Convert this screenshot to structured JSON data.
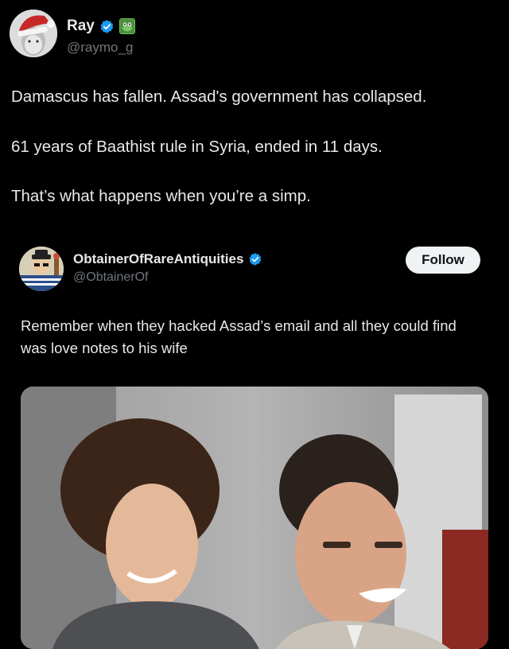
{
  "post": {
    "author": {
      "display_name": "Ray",
      "handle": "@raymo_g",
      "verified": true,
      "avatar_icon": "santa-hat-avatar",
      "badge_icon": "frog-emoji-badge"
    },
    "paragraphs": [
      "Damascus has fallen. Assad's government has collapsed.",
      "61 years of Baathist rule in Syria, ended in 11 days.",
      "That’s what happens when you’re a simp."
    ]
  },
  "quoted_post": {
    "author": {
      "display_name": "ObtainerOfRareAntiquities",
      "handle": "@ObtainerOf",
      "verified": true,
      "avatar_icon": "cartoon-avatar"
    },
    "follow_label": "Follow",
    "text": "Remember when they hacked Assad’s email and all they could find was love notes to his wife",
    "image_icon": "photo-of-smiling-couple"
  },
  "colors": {
    "background": "#000000",
    "text": "#e7e9ea",
    "secondary_text": "#71767b",
    "verified_blue": "#1d9bf0",
    "follow_button_bg": "#eff3f4"
  }
}
